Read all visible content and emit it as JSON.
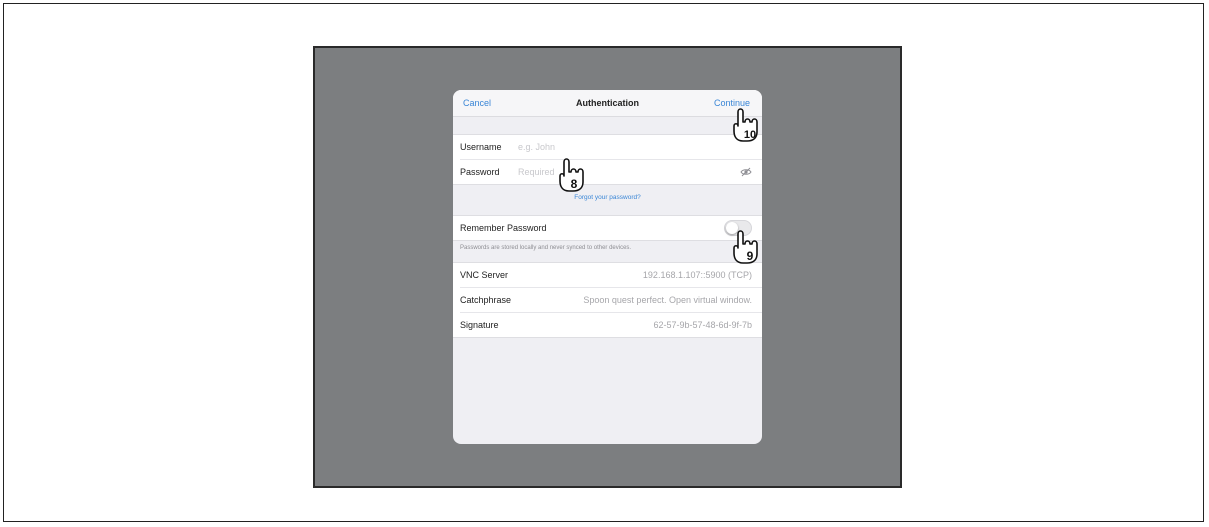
{
  "dialog": {
    "cancel_label": "Cancel",
    "title": "Authentication",
    "continue_label": "Continue"
  },
  "credentials": {
    "username_label": "Username",
    "username_placeholder": "e.g. John",
    "password_label": "Password",
    "password_placeholder": "Required",
    "forgot_label": "Forgot your password?"
  },
  "remember": {
    "label": "Remember Password",
    "enabled": false,
    "note": "Passwords are stored locally and never synced to other devices."
  },
  "server_info": [
    {
      "label": "VNC Server",
      "value": "192.168.1.107::5900 (TCP)"
    },
    {
      "label": "Catchphrase",
      "value": "Spoon quest perfect. Open virtual window."
    },
    {
      "label": "Signature",
      "value": "62-57-9b-57-48-6d-9f-7b"
    }
  ],
  "callouts": {
    "username": "8",
    "remember": "9",
    "continue": "10"
  },
  "icons": {
    "eye": "eye-slash-icon",
    "callout": "pointing-hand-icon"
  },
  "colors": {
    "accent": "#3a86d6",
    "screen_bg": "#7c7e80"
  }
}
